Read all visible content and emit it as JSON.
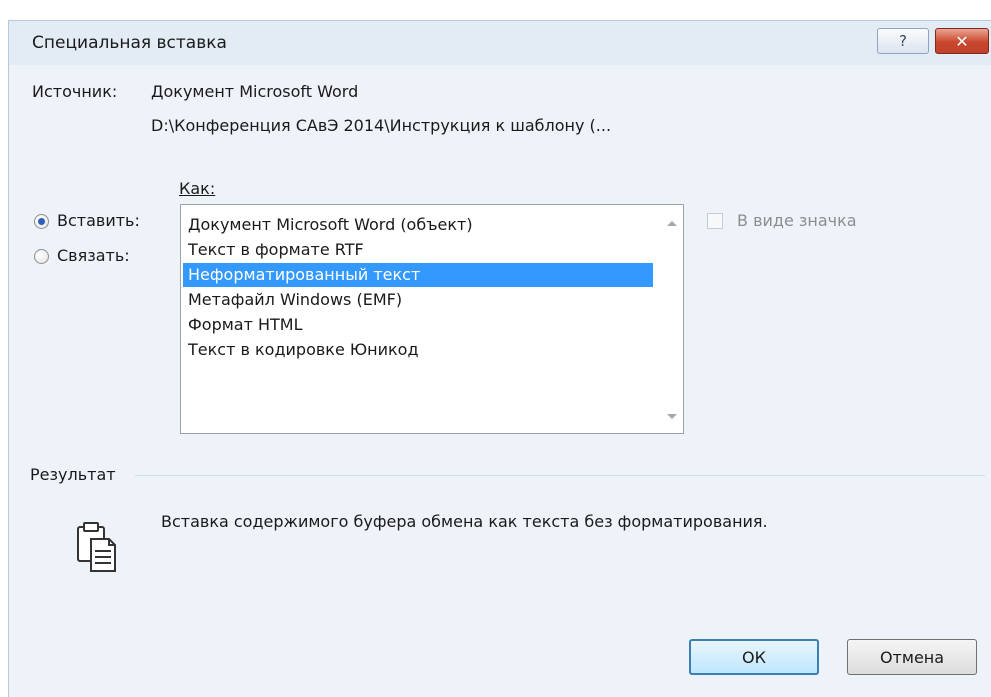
{
  "window": {
    "title": "Специальная вставка",
    "help_label": "?",
    "close_label": "✕"
  },
  "source": {
    "label": "Источник:",
    "name": "Документ Microsoft Word",
    "path": "D:\\Конференция САвЭ 2014\\Инструкция к шаблону (..."
  },
  "as_label": "Как:",
  "options": {
    "paste": {
      "label": "Вставить:",
      "checked": true
    },
    "link": {
      "label": "Связать:",
      "checked": false
    }
  },
  "list": {
    "items": [
      "Документ Microsoft Word (объект)",
      "Текст в формате RTF",
      "Неформатированный текст",
      "Метафайл Windows (EMF)",
      "Формат HTML",
      "Текст в кодировке Юникод"
    ],
    "selected_index": 2
  },
  "icon_checkbox": {
    "label": "В виде значка",
    "checked": false,
    "enabled": false
  },
  "result": {
    "label": "Результат",
    "description": "Вставка содержимого буфера обмена как текста без форматирования.",
    "icon": "clipboard-icon"
  },
  "buttons": {
    "ok": "ОК",
    "cancel": "Отмена"
  },
  "colors": {
    "selection": "#3399ff",
    "window_bg": "#eef3f9",
    "close_button": "#c9472e"
  }
}
